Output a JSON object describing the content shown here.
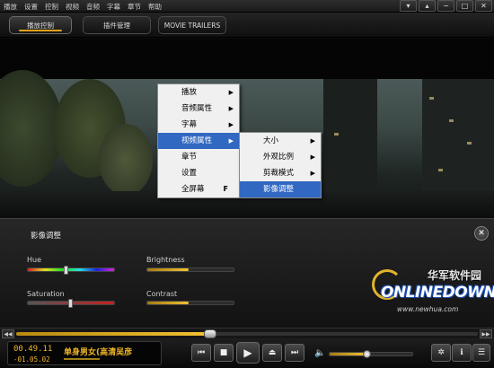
{
  "menubar": {
    "items": [
      "播放",
      "设置",
      "控制",
      "视频",
      "音频",
      "字幕",
      "章节",
      "帮助"
    ],
    "window_buttons": [
      "▾",
      "▴",
      "−",
      "□",
      "✕"
    ]
  },
  "tabs": [
    {
      "label": "播放控制",
      "active": true
    },
    {
      "label": "插件管理",
      "active": false
    },
    {
      "label": "MOVIE TRAILERS",
      "active": false
    }
  ],
  "context_menu": {
    "items": [
      {
        "label": "播放",
        "submenu": true
      },
      {
        "label": "音频属性",
        "submenu": true
      },
      {
        "label": "字幕",
        "submenu": true
      },
      {
        "label": "视频属性",
        "submenu": true,
        "highlighted": true
      },
      {
        "label": "章节",
        "submenu": false
      },
      {
        "label": "设置",
        "submenu": false
      },
      {
        "label": "全屏幕",
        "submenu": false,
        "shortcut": "F"
      }
    ],
    "arrow_glyph": "▶"
  },
  "submenu": {
    "items": [
      {
        "label": "大小",
        "submenu": true
      },
      {
        "label": "外观比例",
        "submenu": true
      },
      {
        "label": "剪裁模式",
        "submenu": true
      },
      {
        "label": "影像调整",
        "submenu": false,
        "highlighted": true
      }
    ]
  },
  "adjust_panel": {
    "title": "影像调整",
    "close_glyph": "✕",
    "sliders": [
      {
        "label": "Hue",
        "value": 0.45
      },
      {
        "label": "Brightness",
        "value": 0.48
      },
      {
        "label": "Saturation",
        "value": 0.5
      },
      {
        "label": "Contrast",
        "value": 0.48
      }
    ]
  },
  "watermark": {
    "chinese": "华军软件园",
    "brand": "ONLINEDOWN",
    "url": "www.newhua.com"
  },
  "seekbar": {
    "prev_glyph": "◀◀",
    "next_glyph": "▶▶",
    "progress": 0.42
  },
  "player": {
    "elapsed": "00.49.11",
    "remaining": "-01.05.02",
    "now_playing": "单身男女(高清吴彦",
    "volume": 0.45,
    "accent_color": "#f0b62a"
  },
  "controls": {
    "prev": "⏮",
    "stop": "■",
    "play": "▶",
    "eject": "⏏",
    "next": "⏭",
    "volume_icon": "🔈",
    "settings": "✲",
    "info": "ℹ",
    "playlist": "☰"
  }
}
